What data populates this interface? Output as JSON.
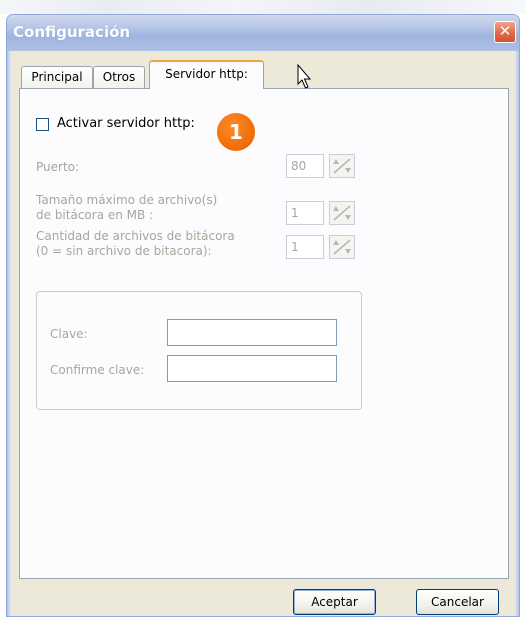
{
  "window": {
    "title": "Configuración",
    "close_label": "✕"
  },
  "tabs": [
    {
      "label": "Principal",
      "active": false
    },
    {
      "label": "Otros",
      "active": false
    },
    {
      "label": "Servidor http:",
      "active": true
    }
  ],
  "http_server": {
    "enable_label": "Activar servidor http:",
    "enable_checked": false,
    "port_label": "Puerto:",
    "port_value": "80",
    "max_log_label_line1": "Tamaño máximo de archivo(s)",
    "max_log_label_line2": "de bitácora en MB :",
    "max_log_value": "1",
    "log_count_label_line1": "Cantidad de archivos de bitácora",
    "log_count_label_line2": "(0 = sin archivo de bitacora):",
    "log_count_value": "1",
    "password_label": "Clave:",
    "password_value": "",
    "confirm_label": "Confirme clave:",
    "confirm_value": ""
  },
  "callout_number": "1",
  "buttons": {
    "accept_label": "Aceptar",
    "cancel_label": "Cancelar"
  },
  "icons": {
    "spin": "spin-arrows-icon",
    "cursor": "mouse-pointer-icon",
    "close": "close-icon"
  },
  "colors": {
    "window_bg": "#ece9d8",
    "titlebar": "#b5c6e6",
    "active_tab_accent": "#f1a43c",
    "callout": "#f06b05",
    "disabled_text": "#a7a69c",
    "close_button": "#e26a49"
  }
}
